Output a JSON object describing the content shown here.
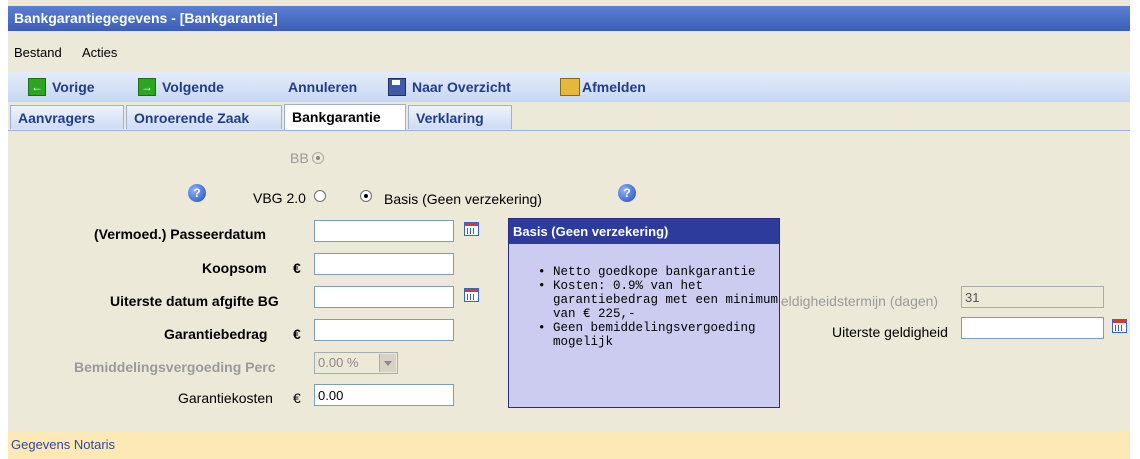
{
  "window": {
    "title": "Bankgarantiegegevens - [Bankgarantie]"
  },
  "menu": {
    "items": [
      "Bestand",
      "Acties"
    ]
  },
  "toolbar": {
    "prev_label": "Vorige",
    "next_label": "Volgende",
    "cancel_label": "Annuleren",
    "overview_label": "Naar Overzicht",
    "logout_label": "Afmelden"
  },
  "tabs": [
    "Aanvragers",
    "Onroerende Zaak",
    "Bankgarantie",
    "Verklaring"
  ],
  "active_tab": "Bankgarantie",
  "form": {
    "bb_label": "BB",
    "vbg_label": "VBG 2.0",
    "basis_label": "Basis (Geen verzekering)",
    "passeerdatum_label": "(Vermoed.) Passeerdatum",
    "passeerdatum_value": "",
    "koopsom_label": "Koopsom",
    "koopsom_currency": "€",
    "koopsom_value": "",
    "uiterste_afgifte_label": "Uiterste datum afgifte BG",
    "uiterste_afgifte_value": "",
    "garantiebedrag_label": "Garantiebedrag",
    "garantiebedrag_currency": "€",
    "garantiebedrag_value": "",
    "bemiddeling_label": "Bemiddelingsvergoeding Perc",
    "bemiddeling_value": "0.00 %",
    "garantiekosten_label": "Garantiekosten",
    "garantiekosten_currency": "€",
    "garantiekosten_value": "0.00",
    "geldigheidstermijn_label": "Geldigheidstermijn (dagen)",
    "geldigheidstermijn_value": "31",
    "uiterste_geldigheid_label": "Uiterste geldigheid",
    "uiterste_geldigheid_value": ""
  },
  "tooltip": {
    "title": "Basis (Geen verzekering)",
    "items": [
      "Netto goedkope bankgarantie",
      "Kosten: 0.9% van het garantiebedrag met een minimum van € 225,-",
      "Geen bemiddelingsvergoeding mogelijk"
    ]
  },
  "footer": {
    "notaris_label": "Gegevens Notaris"
  }
}
